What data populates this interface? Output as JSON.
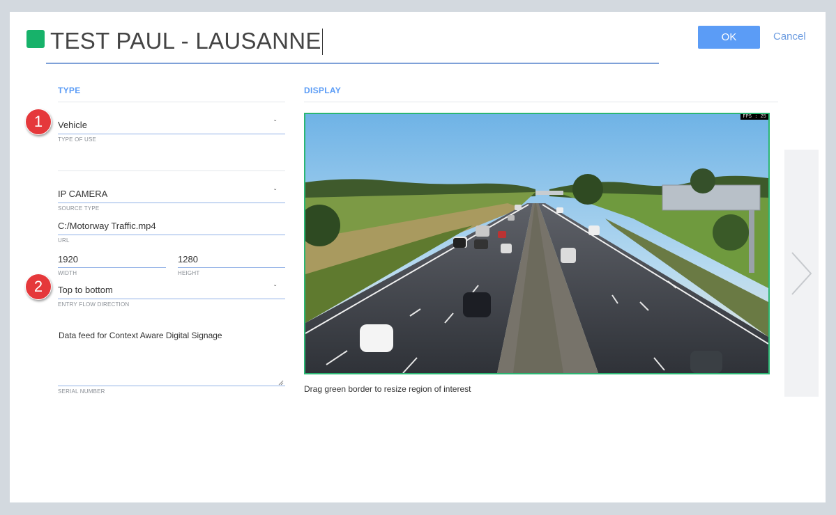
{
  "header": {
    "title": "TEST PAUL - LAUSANNE",
    "swatch_color": "#17b26a",
    "ok_label": "OK",
    "cancel_label": "Cancel"
  },
  "type_section": {
    "heading": "TYPE",
    "type_of_use": {
      "value": "Vehicle",
      "caption": "TYPE OF USE"
    },
    "source_type": {
      "value": "IP CAMERA",
      "caption": "SOURCE TYPE"
    },
    "url": {
      "value": "C:/Motorway Traffic.mp4",
      "caption": "URL"
    },
    "width": {
      "value": "1920",
      "caption": "WIDTH"
    },
    "height": {
      "value": "1280",
      "caption": "HEIGHT"
    },
    "entry_flow": {
      "value": "Top to bottom",
      "caption": "ENTRY FLOW DIRECTION"
    },
    "serial_number": {
      "value": "Data feed for Context Aware Digital Signage",
      "caption": "SERIAL NUMBER"
    }
  },
  "display_section": {
    "heading": "DISPLAY",
    "fps_label": "FPS : 25",
    "hint": "Drag green border to resize region of interest",
    "roi_border_color": "#2bb673"
  },
  "annotations": {
    "badge_1": "1",
    "badge_2": "2"
  },
  "colors": {
    "accent": "#5b9cf6",
    "badge_red": "#e5383b"
  }
}
